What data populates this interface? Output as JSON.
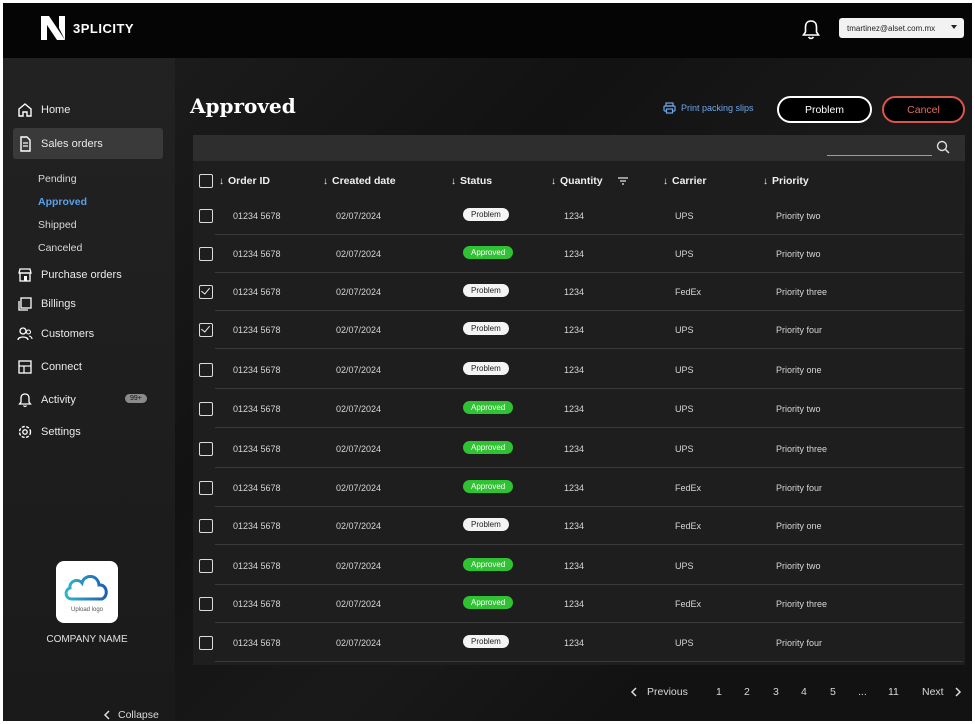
{
  "app": {
    "logo_text": "3PLICITY",
    "account_email": "tmartinez@alset.com.mx"
  },
  "sidebar": {
    "items": [
      {
        "label": "Home",
        "icon": "home-icon"
      },
      {
        "label": "Sales orders",
        "icon": "document-icon"
      },
      {
        "label": "Purchase orders",
        "icon": "store-icon"
      },
      {
        "label": "Billings",
        "icon": "billing-icon"
      },
      {
        "label": "Customers",
        "icon": "users-icon"
      },
      {
        "label": "Connect",
        "icon": "connect-icon"
      },
      {
        "label": "Activity",
        "icon": "bell-icon",
        "badge": "99+"
      },
      {
        "label": "Settings",
        "icon": "gear-icon"
      }
    ],
    "sub_items": [
      "Pending",
      "Approved",
      "Shipped",
      "Canceled"
    ],
    "company_logo_text": "Upload logo",
    "company_name": "COMPANY NAME",
    "collapse_label": "Collapse"
  },
  "main": {
    "title": "Approved",
    "print_label": "Print packing slips",
    "problem_button": "Problem",
    "cancel_button": "Cancel",
    "columns": [
      "Order ID",
      "Created date",
      "Status",
      "Quantity",
      "Carrier",
      "Priority"
    ],
    "rows": [
      {
        "checked": false,
        "order_id": "01234 5678",
        "date": "02/07/2024",
        "status": "Problem",
        "qty": "1234",
        "carrier": "UPS",
        "priority": "Priority two"
      },
      {
        "checked": false,
        "order_id": "01234 5678",
        "date": "02/07/2024",
        "status": "Approved",
        "qty": "1234",
        "carrier": "UPS",
        "priority": "Priority two"
      },
      {
        "checked": true,
        "order_id": "01234 5678",
        "date": "02/07/2024",
        "status": "Problem",
        "qty": "1234",
        "carrier": "FedEx",
        "priority": "Priority three"
      },
      {
        "checked": true,
        "order_id": "01234 5678",
        "date": "02/07/2024",
        "status": "Problem",
        "qty": "1234",
        "carrier": "UPS",
        "priority": "Priority four"
      },
      {
        "checked": false,
        "order_id": "01234 5678",
        "date": "02/07/2024",
        "status": "Problem",
        "qty": "1234",
        "carrier": "UPS",
        "priority": "Priority one"
      },
      {
        "checked": false,
        "order_id": "01234 5678",
        "date": "02/07/2024",
        "status": "Approved",
        "qty": "1234",
        "carrier": "UPS",
        "priority": "Priority two"
      },
      {
        "checked": false,
        "order_id": "01234 5678",
        "date": "02/07/2024",
        "status": "Approved",
        "qty": "1234",
        "carrier": "UPS",
        "priority": "Priority three"
      },
      {
        "checked": false,
        "order_id": "01234 5678",
        "date": "02/07/2024",
        "status": "Approved",
        "qty": "1234",
        "carrier": "FedEx",
        "priority": "Priority four"
      },
      {
        "checked": false,
        "order_id": "01234 5678",
        "date": "02/07/2024",
        "status": "Problem",
        "qty": "1234",
        "carrier": "FedEx",
        "priority": "Priority one"
      },
      {
        "checked": false,
        "order_id": "01234 5678",
        "date": "02/07/2024",
        "status": "Approved",
        "qty": "1234",
        "carrier": "UPS",
        "priority": "Priority two"
      },
      {
        "checked": false,
        "order_id": "01234 5678",
        "date": "02/07/2024",
        "status": "Approved",
        "qty": "1234",
        "carrier": "FedEx",
        "priority": "Priority three"
      },
      {
        "checked": false,
        "order_id": "01234 5678",
        "date": "02/07/2024",
        "status": "Problem",
        "qty": "1234",
        "carrier": "UPS",
        "priority": "Priority four"
      }
    ]
  },
  "pagination": {
    "previous": "Previous",
    "next": "Next",
    "pages": [
      "1",
      "2",
      "3",
      "4",
      "5",
      "...",
      "11"
    ]
  },
  "colors": {
    "accent_blue": "#5aa0e8",
    "approved_green": "#2fc232",
    "cancel_red": "#d8564a"
  }
}
